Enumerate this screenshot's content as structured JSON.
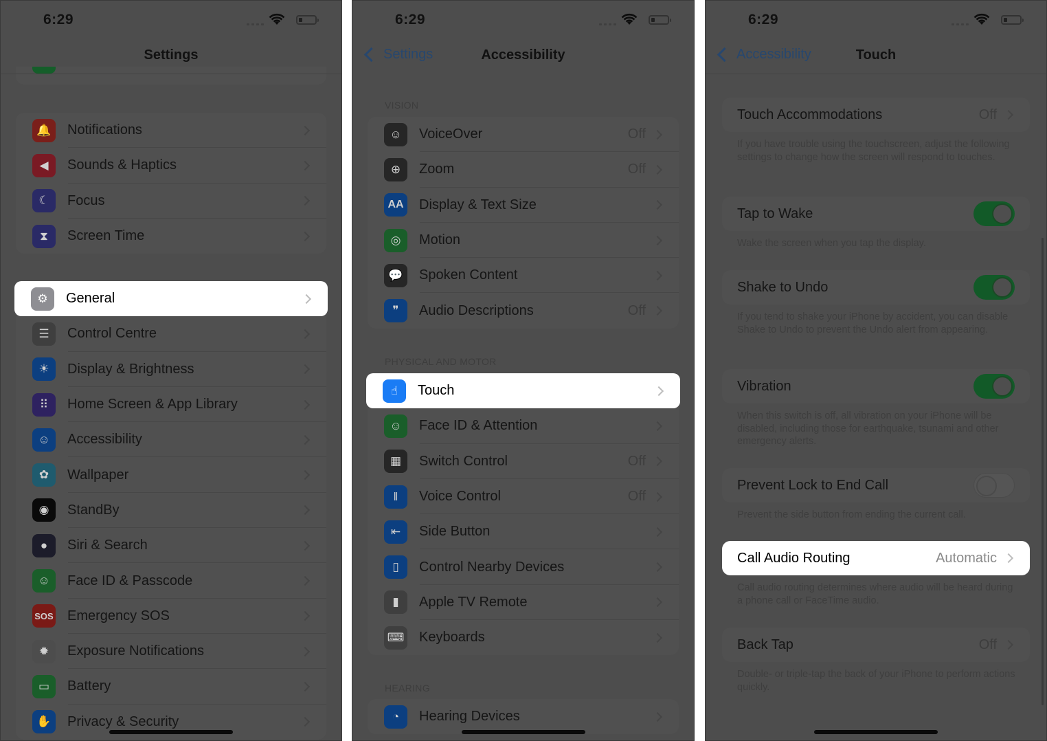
{
  "status_bar": {
    "time": "6:29"
  },
  "colors": {
    "dim_background": "#4d4d4d",
    "highlight": "#ffffff",
    "toggle_on": "#125a28",
    "link": "#27476e"
  },
  "panel1": {
    "title": "Settings",
    "groups": [
      [
        {
          "label": "Notifications",
          "icon": "bell-icon",
          "color": "#7a1f1a"
        },
        {
          "label": "Sounds & Haptics",
          "icon": "speaker-icon",
          "color": "#7a1a24"
        },
        {
          "label": "Focus",
          "icon": "moon-icon",
          "color": "#2a2a66"
        },
        {
          "label": "Screen Time",
          "icon": "hourglass-icon",
          "color": "#2a2a66"
        }
      ],
      [
        {
          "label": "General",
          "icon": "gear-icon",
          "color": "#8e8e93",
          "highlighted": true
        },
        {
          "label": "Control Centre",
          "icon": "toggles-icon",
          "color": "#3f3f3f"
        },
        {
          "label": "Display & Brightness",
          "icon": "sun-icon",
          "color": "#0c3f80"
        },
        {
          "label": "Home Screen & App Library",
          "icon": "app-grid-icon",
          "color": "#2e2260"
        },
        {
          "label": "Accessibility",
          "icon": "accessibility-icon",
          "color": "#0c3f80"
        },
        {
          "label": "Wallpaper",
          "icon": "flower-icon",
          "color": "#1f5b6e"
        },
        {
          "label": "StandBy",
          "icon": "standby-icon",
          "color": "#0a0a0a"
        },
        {
          "label": "Siri & Search",
          "icon": "siri-icon",
          "color": "#1c1c2a"
        },
        {
          "label": "Face ID & Passcode",
          "icon": "face-id-icon",
          "color": "#1a5e2a"
        },
        {
          "label": "Emergency SOS",
          "icon": "sos-icon",
          "color": "#7a1a16",
          "icon_text": "SOS"
        },
        {
          "label": "Exposure Notifications",
          "icon": "exposure-icon",
          "color": "#4d4d4d"
        },
        {
          "label": "Battery",
          "icon": "battery-icon",
          "color": "#1a5e2a"
        },
        {
          "label": "Privacy & Security",
          "icon": "hand-icon",
          "color": "#0c3f80"
        }
      ]
    ]
  },
  "panel2": {
    "back_label": "Settings",
    "title": "Accessibility",
    "sections": [
      {
        "header": "VISION",
        "items": [
          {
            "label": "VoiceOver",
            "value": "Off",
            "icon": "voiceover-icon",
            "color": "#262626"
          },
          {
            "label": "Zoom",
            "value": "Off",
            "icon": "zoom-icon",
            "color": "#262626"
          },
          {
            "label": "Display & Text Size",
            "value": "",
            "icon": "text-size-icon",
            "color": "#0c3f80",
            "icon_text": "AA"
          },
          {
            "label": "Motion",
            "value": "",
            "icon": "motion-icon",
            "color": "#1a5e2a"
          },
          {
            "label": "Spoken Content",
            "value": "",
            "icon": "speech-bubble-icon",
            "color": "#262626"
          },
          {
            "label": "Audio Descriptions",
            "value": "Off",
            "icon": "quote-bubble-icon",
            "color": "#0c3f80"
          }
        ]
      },
      {
        "header": "PHYSICAL AND MOTOR",
        "items": [
          {
            "label": "Touch",
            "value": "",
            "icon": "hand-pointer-icon",
            "color": "#1a7cf5",
            "highlighted": true
          },
          {
            "label": "Face ID & Attention",
            "value": "",
            "icon": "face-id-icon",
            "color": "#1a5e2a"
          },
          {
            "label": "Switch Control",
            "value": "Off",
            "icon": "switch-grid-icon",
            "color": "#262626"
          },
          {
            "label": "Voice Control",
            "value": "Off",
            "icon": "waveform-icon",
            "color": "#0c3f80"
          },
          {
            "label": "Side Button",
            "value": "",
            "icon": "side-button-icon",
            "color": "#0c3f80"
          },
          {
            "label": "Control Nearby Devices",
            "value": "",
            "icon": "nearby-devices-icon",
            "color": "#0c3f80"
          },
          {
            "label": "Apple TV Remote",
            "value": "",
            "icon": "remote-icon",
            "color": "#3f3f3f"
          },
          {
            "label": "Keyboards",
            "value": "",
            "icon": "keyboard-icon",
            "color": "#3f3f3f"
          }
        ]
      },
      {
        "header": "HEARING",
        "items": [
          {
            "label": "Hearing Devices",
            "value": "",
            "icon": "ear-icon",
            "color": "#0c3f80"
          }
        ]
      }
    ]
  },
  "panel3": {
    "back_label": "Accessibility",
    "title": "Touch",
    "settings": [
      {
        "label": "Touch Accommodations",
        "type": "link",
        "value": "Off",
        "footer": "If you have trouble using the touchscreen, adjust the following settings to change how the screen will respond to touches."
      },
      {
        "label": "Tap to Wake",
        "type": "toggle",
        "on": true,
        "footer": "Wake the screen when you tap the display."
      },
      {
        "label": "Shake to Undo",
        "type": "toggle",
        "on": true,
        "footer": "If you tend to shake your iPhone by accident, you can disable Shake to Undo to prevent the Undo alert from appearing."
      },
      {
        "label": "Vibration",
        "type": "toggle",
        "on": true,
        "footer": "When this switch is off, all vibration on your iPhone will be disabled, including those for earthquake, tsunami and other emergency alerts."
      },
      {
        "label": "Prevent Lock to End Call",
        "type": "toggle",
        "on": false,
        "footer": "Prevent the side button from ending the current call."
      },
      {
        "label": "Call Audio Routing",
        "type": "link",
        "value": "Automatic",
        "highlighted": true,
        "footer": "Call audio routing determines where audio will be heard during a phone call or FaceTime audio."
      },
      {
        "label": "Back Tap",
        "type": "link",
        "value": "Off",
        "footer": "Double- or triple-tap the back of your iPhone to perform actions quickly."
      }
    ]
  }
}
